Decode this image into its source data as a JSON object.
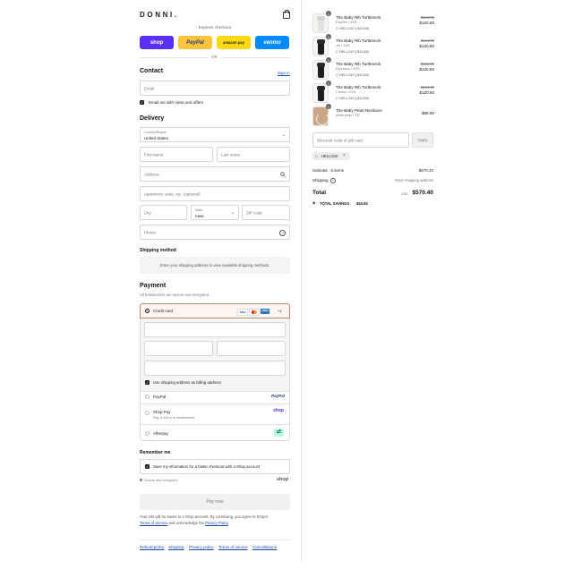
{
  "brand": {
    "logo": "DONNI."
  },
  "express": {
    "title": "Express checkout",
    "shop": "shop",
    "paypal": "PayPal",
    "amazon": "amazon pay",
    "venmo": "venmo",
    "or": "OR"
  },
  "contact": {
    "title": "Contact",
    "signin": "Sign in",
    "email_placeholder": "Email",
    "news_label": "Email me with news and offers"
  },
  "delivery": {
    "title": "Delivery",
    "country_label": "Country/Region",
    "country_value": "United States",
    "first_name": "First name",
    "last_name": "Last name",
    "address": "Address",
    "apartment": "Apartment, suite, etc. (optional)",
    "city": "City",
    "state_label": "State",
    "state_value": "Iowa",
    "zip": "ZIP code",
    "phone": "Phone"
  },
  "shipping_method": {
    "title": "Shipping method",
    "message": "Enter your shipping address to view available shipping methods."
  },
  "payment": {
    "title": "Payment",
    "subtitle": "All transactions are secure and encrypted.",
    "credit_card": "Credit card",
    "visa": "VISA",
    "amex": "AMEX",
    "more": "+4",
    "billing_same": "Use shipping address as billing address",
    "paypal": "PayPal",
    "paypal_logo": "PayPal",
    "shoppay": "Shop Pay",
    "shoppay_sub": "Pay in full or in installments",
    "shoppay_logo": "shop",
    "afterpay": "Afterpay"
  },
  "remember": {
    "title": "Remember me",
    "label": "Save my information for a faster checkout with a Shop account",
    "secure": "Secure and encrypted",
    "shop_logo": "shop"
  },
  "pay_now": "Pay now",
  "disclaimer": {
    "line1": "Your info will be saved to a Shop account. By continuing, you agree to Shop's",
    "terms": "Terms of Service",
    "mid": " and acknowledge the ",
    "privacy": "Privacy Policy",
    "end": "."
  },
  "footer": [
    "Refund policy",
    "Shipping",
    "Privacy policy",
    "Terms of service",
    "Cancellations"
  ],
  "cart": {
    "items": [
      {
        "qty": "1",
        "name": "The Baby Rib Turtleneck",
        "variant": "Powder / XXS",
        "discount": "HELLO10 (-$13.60)",
        "original": "$134.00",
        "price": "$120.60",
        "img": "light"
      },
      {
        "qty": "1",
        "name": "The Baby Rib Turtleneck",
        "variant": "Jet / XXS",
        "discount": "HELLO10 (-$13.60)",
        "original": "$134.00",
        "price": "$120.60",
        "img": "dark"
      },
      {
        "qty": "1",
        "name": "The Baby Rib Turtleneck",
        "variant": "Espresso / XXS",
        "discount": "HELLO10 (-$13.60)",
        "original": "$134.00",
        "price": "$120.60",
        "img": "dark"
      },
      {
        "qty": "1",
        "name": "The Baby Rib Turtleneck",
        "variant": "Crema / XXS",
        "discount": "HELLO10 (-$13.60)",
        "original": "$134.00",
        "price": "$120.60",
        "img": "dark"
      },
      {
        "qty": "1",
        "name": "The Baby Pearl Necklace",
        "variant": "white pearl / 16\"",
        "discount": "",
        "original": "",
        "price": "$88.00",
        "img": "pearl"
      }
    ],
    "discount_placeholder": "Discount code or gift card",
    "apply": "Apply",
    "code_tag": "HELLO10",
    "subtotal_label": "Subtotal · 5 items",
    "subtotal": "$570.40",
    "shipping_label": "Shipping",
    "shipping_value": "Enter shipping address",
    "total_label": "Total",
    "currency": "USD",
    "total": "$570.40",
    "savings_label": "TOTAL SAVINGS",
    "savings": "$53.60"
  },
  "colors": {
    "shop": "#5a31f4",
    "paypal": "#ffc439",
    "amazon": "#ffd814",
    "venmo": "#008cff",
    "link": "#1a4fb0"
  }
}
